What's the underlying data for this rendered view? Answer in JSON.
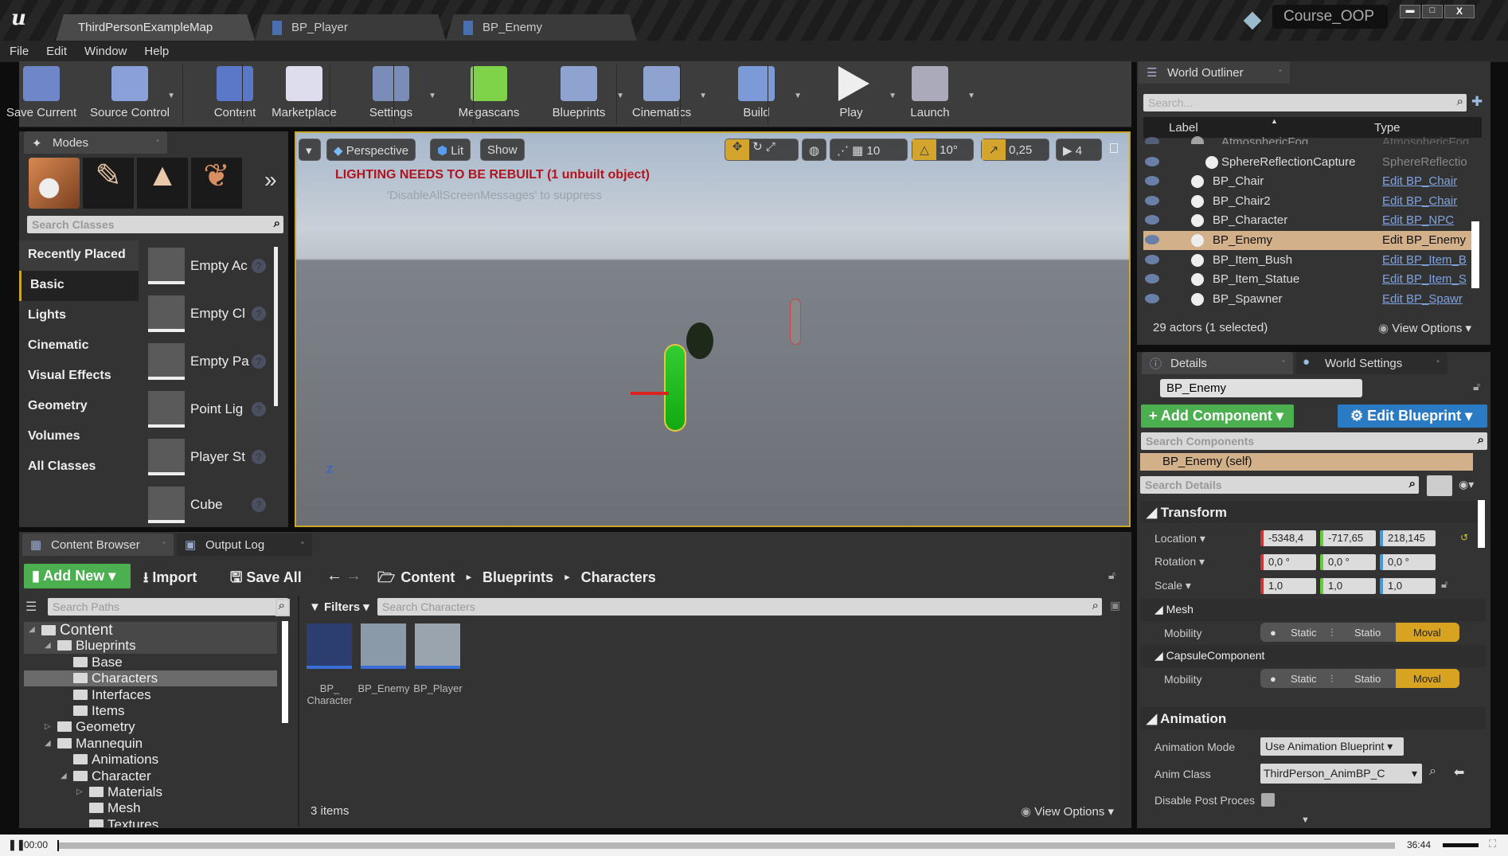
{
  "window": {
    "logo": "Unreal Engine logo",
    "project": "Course_OOP",
    "controls": [
      "minimize",
      "maximize",
      "close"
    ]
  },
  "tabs": [
    {
      "label": "ThirdPersonExampleMap"
    },
    {
      "label": "BP_Player"
    },
    {
      "label": "BP_Enemy"
    }
  ],
  "menu": [
    "File",
    "Edit",
    "Window",
    "Help"
  ],
  "toolbar": [
    {
      "label": "Save Current",
      "icon": "floppy-icon"
    },
    {
      "label": "Source Control",
      "icon": "source-control-icon"
    },
    {
      "label": "Content",
      "icon": "content-icon"
    },
    {
      "label": "Marketplace",
      "icon": "marketplace-icon"
    },
    {
      "label": "Settings",
      "icon": "gear-icon"
    },
    {
      "label": "Megascans",
      "icon": "megascans-icon"
    },
    {
      "label": "Blueprints",
      "icon": "blueprints-icon"
    },
    {
      "label": "Cinematics",
      "icon": "clapper-icon"
    },
    {
      "label": "Build",
      "icon": "build-icon"
    },
    {
      "label": "Play",
      "icon": "play-icon"
    },
    {
      "label": "Launch",
      "icon": "launch-icon"
    }
  ],
  "modes": {
    "title": "Modes",
    "search_placeholder": "Search Classes",
    "categories": [
      "Recently Placed",
      "Basic",
      "Lights",
      "Cinematic",
      "Visual Effects",
      "Geometry",
      "Volumes",
      "All Classes"
    ],
    "selected_category": "Basic",
    "items": [
      "Empty Ac",
      "Empty Cl",
      "Empty Pa",
      "Point Lig",
      "Player St",
      "Cube"
    ]
  },
  "viewport": {
    "view": "Perspective",
    "lit": "Lit",
    "show": "Show",
    "grid": "10",
    "angle": "10°",
    "scale": "0,25",
    "camera_speed": "4",
    "warning": "LIGHTING NEEDS TO BE REBUILT (1 unbuilt object)",
    "hint": "'DisableAllScreenMessages' to suppress",
    "axis_z": "Z"
  },
  "outliner": {
    "title": "World Outliner",
    "search_placeholder": "Search...",
    "col_label": "Label",
    "col_type": "Type",
    "rows": [
      {
        "label": "AtmosphericFog",
        "type": "AtmosphericFog",
        "link": false
      },
      {
        "label": "SphereReflectionCapture",
        "type": "SphereReflectio",
        "link": false
      },
      {
        "label": "BP_Chair",
        "type": "Edit BP_Chair",
        "link": true
      },
      {
        "label": "BP_Chair2",
        "type": "Edit BP_Chair",
        "link": true
      },
      {
        "label": "BP_Character",
        "type": "Edit BP_NPC",
        "link": true
      },
      {
        "label": "BP_Enemy",
        "type": "Edit BP_Enemy",
        "link": true,
        "selected": true
      },
      {
        "label": "BP_Item_Bush",
        "type": "Edit BP_Item_B",
        "link": true
      },
      {
        "label": "BP_Item_Statue",
        "type": "Edit BP_Item_S",
        "link": true
      },
      {
        "label": "BP_Spawner",
        "type": "Edit BP_Spawr",
        "link": true
      }
    ],
    "status": "29 actors (1 selected)",
    "view_options": "View Options"
  },
  "details": {
    "tab": "Details",
    "tab2": "World Settings",
    "name": "BP_Enemy",
    "add_component": "Add Component",
    "edit_blueprint": "Edit Blueprint",
    "search_components": "Search Components",
    "self": "BP_Enemy (self)",
    "search_details": "Search Details",
    "transform": "Transform",
    "location_label": "Location",
    "location": [
      "-5348,4",
      "-717,65",
      "218,145"
    ],
    "rotation_label": "Rotation",
    "rotation": [
      "0,0 °",
      "0,0 °",
      "0,0 °"
    ],
    "scale_label": "Scale",
    "scale": [
      "1,0",
      "1,0",
      "1,0"
    ],
    "mesh": "Mesh",
    "mobility": "Mobility",
    "mobility_options": [
      "Static",
      "Statio",
      "Moval"
    ],
    "mobility_selected": "Moval",
    "capsule": "CapsuleComponent",
    "animation": "Animation",
    "anim_mode_label": "Animation Mode",
    "anim_mode": "Use Animation Blueprint",
    "anim_class_label": "Anim Class",
    "anim_class": "ThirdPerson_AnimBP_C",
    "disable_pp_label": "Disable Post Proces",
    "disable_pp": false
  },
  "content_browser": {
    "tab": "Content Browser",
    "tab2": "Output Log",
    "add_new": "Add New",
    "import": "Import",
    "save_all": "Save All",
    "path": [
      "Content",
      "Blueprints",
      "Characters"
    ],
    "search_paths": "Search Paths",
    "filters": "Filters",
    "search_assets": "Search Characters",
    "tree": [
      {
        "label": "Content",
        "depth": 0,
        "exp": "open"
      },
      {
        "label": "Blueprints",
        "depth": 1,
        "exp": "open"
      },
      {
        "label": "Base",
        "depth": 2
      },
      {
        "label": "Characters",
        "depth": 2,
        "selected": true
      },
      {
        "label": "Interfaces",
        "depth": 2
      },
      {
        "label": "Items",
        "depth": 2
      },
      {
        "label": "Geometry",
        "depth": 1,
        "exp": "closed"
      },
      {
        "label": "Mannequin",
        "depth": 1,
        "exp": "open"
      },
      {
        "label": "Animations",
        "depth": 2
      },
      {
        "label": "Character",
        "depth": 2,
        "exp": "open"
      },
      {
        "label": "Materials",
        "depth": 3,
        "exp": "closed"
      },
      {
        "label": "Mesh",
        "depth": 3
      },
      {
        "label": "Textures",
        "depth": 3
      }
    ],
    "assets": [
      {
        "label": "BP_ Character"
      },
      {
        "label": "BP_Enemy"
      },
      {
        "label": "BP_Player"
      }
    ],
    "count": "3 items",
    "view_options": "View Options"
  },
  "video": {
    "current": "00:00",
    "total": "36:44",
    "progress": 0.0,
    "volume": 0.85
  },
  "colors": {
    "accent": "#d8a320",
    "add_green": "#4caf50",
    "edit_blue": "#2a7bc4",
    "selected": "#d1b08a",
    "warning": "#b0141e"
  }
}
